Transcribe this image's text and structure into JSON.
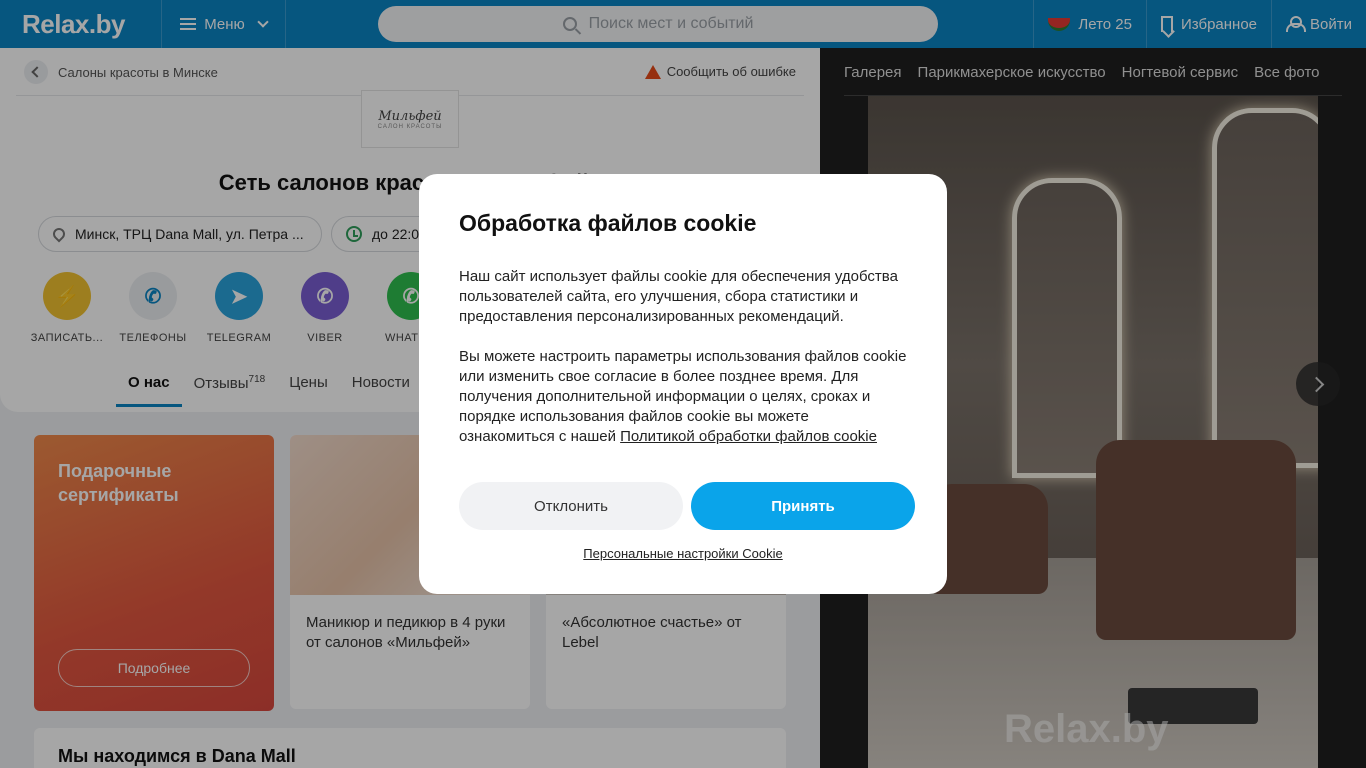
{
  "header": {
    "logo": "Relax.by",
    "menu_label": "Меню",
    "search_placeholder": "Поиск мест и событий",
    "summer_label": "Лето 25",
    "favorites_label": "Избранное",
    "login_label": "Войти",
    "brand_color": "#0a84c4"
  },
  "breadcrumb": {
    "label": "Салоны красоты в Минске"
  },
  "report_label": "Сообщить об ошибке",
  "salon": {
    "logo_text": "Мильфей",
    "logo_subtext": "САЛОН КРАСОТЫ",
    "title": "Сеть салонов красоты «Мильфей»",
    "address": "Минск, ТРЦ Dana Mall, ул. Петра ...",
    "hours": "до 22:00"
  },
  "actions": [
    {
      "label": "ЗАПИСАТЬ...",
      "icon": "no-call-icon",
      "color": "#f2c230"
    },
    {
      "label": "ТЕЛЕФОНЫ",
      "icon": "phone-icon",
      "color": "#eceef1"
    },
    {
      "label": "TELEGRAM",
      "icon": "telegram-icon",
      "color": "#2aa3dc"
    },
    {
      "label": "VIBER",
      "icon": "viber-icon",
      "color": "#7a5fd3"
    },
    {
      "label": "WHATS...",
      "icon": "whatsapp-icon",
      "color": "#2fbf4f"
    }
  ],
  "tabs": {
    "about": "О нас",
    "reviews": "Отзывы",
    "reviews_count": "718",
    "prices": "Цены",
    "news": "Новости"
  },
  "promo": {
    "title": "Подарочные сертификаты",
    "button": "Подробнее"
  },
  "offers": [
    {
      "text": "Маникюр и педикюр в 4 руки от салонов «Мильфей»"
    },
    {
      "text": "«Абсолютное счастье» от Lebel"
    }
  ],
  "location": {
    "title": "Мы находимся в Dana Mall"
  },
  "gallery": {
    "tabs": [
      "Галерея",
      "Парикмахерское искусство",
      "Ногтевой сервис",
      "Все фото"
    ],
    "watermark": "Relax.by"
  },
  "cookie": {
    "title": "Обработка файлов cookie",
    "para1": "Наш сайт использует файлы cookie для обеспечения удобства пользователей сайта, его улучшения, сбора статистики и предоставления персонализированных рекомендаций.",
    "para2": "Вы можете настроить параметры использования файлов cookie или изменить свое согласие в более позднее время. Для получения дополнительной информации о целях, сроках и порядке использования файлов cookie вы можете ознакомиться с нашей",
    "policy_link": "Политикой обработки файлов cookie",
    "decline": "Отклонить",
    "accept": "Принять",
    "settings": "Персональные настройки Cookie",
    "accept_color": "#0aa4ea"
  }
}
